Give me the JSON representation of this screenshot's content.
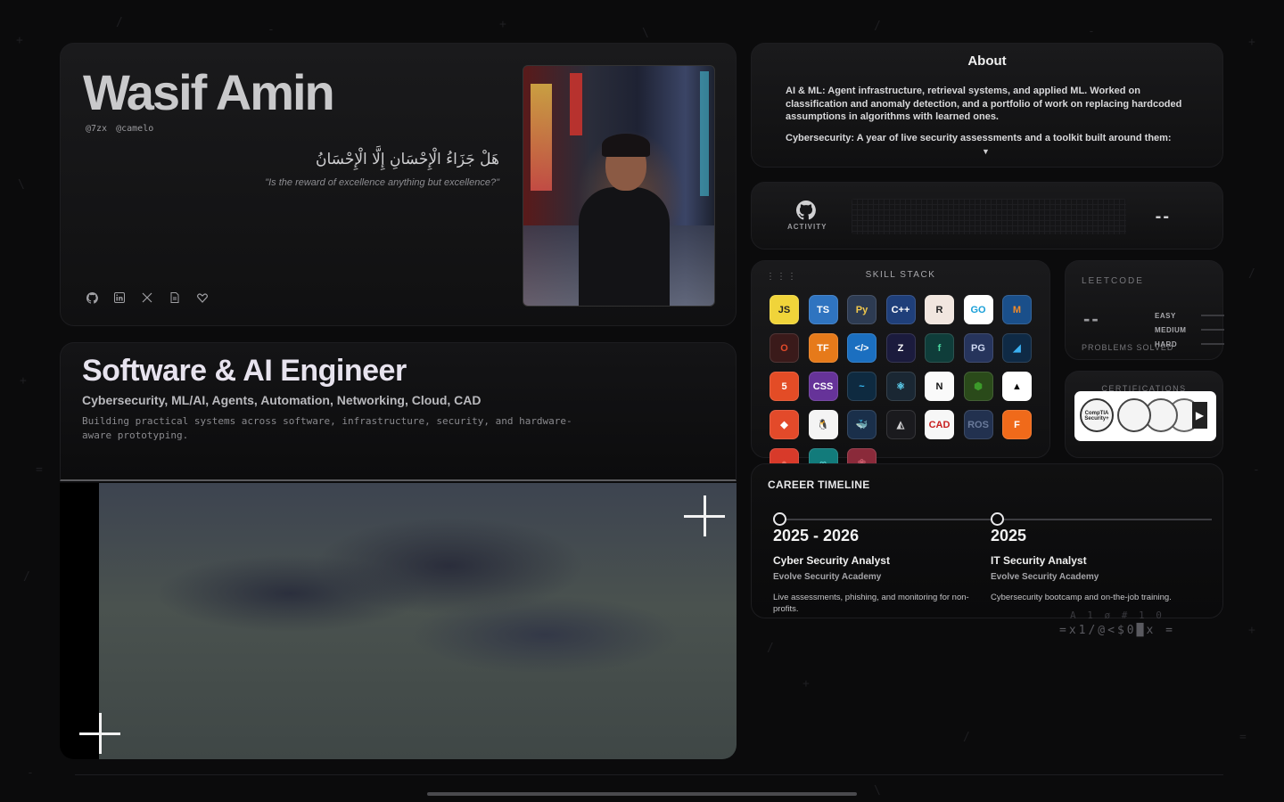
{
  "hero": {
    "name": "Wasif Amin",
    "handle_1": "@7zx",
    "handle_2": "@camelo",
    "arabic_verse": "هَلْ جَزَاءُ الْإِحْسَانِ إِلَّا الْإِحْسَانُ",
    "verse_translation": "\"Is the reward of excellence anything but excellence?\"",
    "social_icons": [
      "github-icon",
      "linkedin-icon",
      "x-icon",
      "document-icon",
      "heart-icon"
    ]
  },
  "title_card": {
    "role": "Software & AI Engineer",
    "areas": "Cybersecurity, ML/AI, Agents, Automation, Networking, Cloud, CAD",
    "tagline": "Building practical systems across software, infrastructure, security, and hardware-aware prototyping."
  },
  "about": {
    "heading": "About",
    "paragraph_1": "AI & ML: Agent infrastructure, retrieval systems, and applied ML. Worked on classification and anomaly detection, and a portfolio of work on replacing hardcoded assumptions in algorithms with learned ones.",
    "paragraph_2": "Cybersecurity: A year of live security assessments and a toolkit built around them:",
    "expand_icon": "chevron-down-icon"
  },
  "activity": {
    "label": "ACTIVITY",
    "count": "--"
  },
  "skills": {
    "heading": "SKILL STACK",
    "items": [
      {
        "label": "JS",
        "bg": "#f0d43a",
        "fg": "#222"
      },
      {
        "label": "TS",
        "bg": "#2f74c0",
        "fg": "#fff"
      },
      {
        "label": "Py",
        "bg": "#2d3b52",
        "fg": "#f2c94c"
      },
      {
        "label": "C++",
        "bg": "#1f3f7a",
        "fg": "#fff"
      },
      {
        "label": "R",
        "bg": "#f1e6df",
        "fg": "#222"
      },
      {
        "label": "GO",
        "bg": "#ffffff",
        "fg": "#1aa0d8"
      },
      {
        "label": "M",
        "bg": "#1a4f8a",
        "fg": "#f08a2a"
      },
      {
        "label": "O",
        "bg": "#3a1a1a",
        "fg": "#e34a2a"
      },
      {
        "label": "TF",
        "bg": "#e67a1a",
        "fg": "#fff"
      },
      {
        "label": "</>",
        "bg": "#1b6fc0",
        "fg": "#fff"
      },
      {
        "label": "Z",
        "bg": "#1b1b3d",
        "fg": "#fff"
      },
      {
        "label": "f",
        "bg": "#0f3d3a",
        "fg": "#4ad7a0"
      },
      {
        "label": "PG",
        "bg": "#26345c",
        "fg": "#cfd9f2"
      },
      {
        "label": "◢",
        "bg": "#0f2a45",
        "fg": "#3ab0f2"
      },
      {
        "label": "5",
        "bg": "#e34c26",
        "fg": "#fff"
      },
      {
        "label": "CSS",
        "bg": "#663399",
        "fg": "#fff"
      },
      {
        "label": "~",
        "bg": "#0e2a40",
        "fg": "#38bdf8"
      },
      {
        "label": "⚛",
        "bg": "#1a2733",
        "fg": "#61dafb"
      },
      {
        "label": "N",
        "bg": "#fafafa",
        "fg": "#111"
      },
      {
        "label": "⬢",
        "bg": "#2a4a1a",
        "fg": "#3c9a2a"
      },
      {
        "label": "▲",
        "bg": "#ffffff",
        "fg": "#000"
      },
      {
        "label": "◆",
        "bg": "#e34a2a",
        "fg": "#fff"
      },
      {
        "label": "🐧",
        "bg": "#f4f4f4",
        "fg": "#222"
      },
      {
        "label": "🐳",
        "bg": "#1a2f4a",
        "fg": "#2496ed"
      },
      {
        "label": "◭",
        "bg": "#1a1a1e",
        "fg": "#cfcfd1"
      },
      {
        "label": "CAD",
        "bg": "#f7f7f7",
        "fg": "#c81e1e"
      },
      {
        "label": "ROS",
        "bg": "#22314f",
        "fg": "#6a7a9a"
      },
      {
        "label": "F",
        "bg": "#f06a1a",
        "fg": "#fff"
      },
      {
        "label": "●",
        "bg": "#d83a2a",
        "fg": "#f06a5a"
      },
      {
        "label": "∞",
        "bg": "#127b7b",
        "fg": "#5ad0d0"
      },
      {
        "label": "❀",
        "bg": "#8a2a3a",
        "fg": "#c85a6a"
      }
    ]
  },
  "leetcode": {
    "heading": "LEETCODE",
    "solved_count": "--",
    "solved_label": "PROBLEMS SOLVED",
    "difficulties": [
      "EASY",
      "MEDIUM",
      "HARD"
    ]
  },
  "certifications": {
    "heading": "CERTIFICATIONS",
    "badge_1": "CompTIA Security+"
  },
  "timeline": {
    "heading": "CAREER TIMELINE",
    "entries": [
      {
        "years": "2025 - 2026",
        "title": "Cyber Security Analyst",
        "org": "Evolve Security Academy",
        "desc": "Live assessments, phishing, and monitoring for non-profits."
      },
      {
        "years": "2025",
        "title": "IT Security Analyst",
        "org": "Evolve Security Academy",
        "desc": "Cybersecurity bootcamp and on-the-job training."
      }
    ]
  },
  "decor": {
    "glyph_row": "=x1/@<$0█x =",
    "glyph_row_faint": "A 1 ø # 1 0"
  }
}
